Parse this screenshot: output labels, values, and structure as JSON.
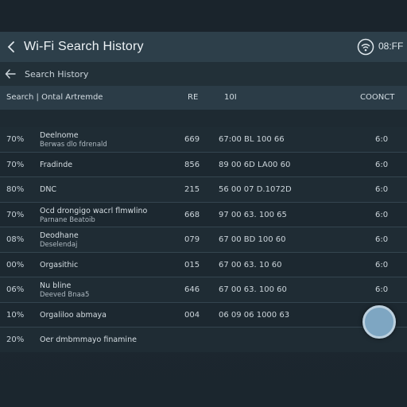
{
  "app": {
    "title": "Wi-Fi Search History",
    "right_label": "08:FF",
    "back_icon": "arrow-left-icon",
    "wifi_icon": "wifi-icon"
  },
  "subbar": {
    "title": "Search History",
    "back_icon": "arrow-left-icon"
  },
  "table": {
    "headers": {
      "col1": "Search | Ontal Artremde",
      "col2": "RE",
      "col3": "10I",
      "col4": "COONCT"
    },
    "rows": [
      {
        "pct": "70%",
        "name": "Deelnome",
        "sub": "Berwas dlo fdrenald",
        "rs": "669",
        "id": "67:00 BL 100 66",
        "cnt": "6:0"
      },
      {
        "pct": "70%",
        "name": "Fradinde",
        "sub": "",
        "rs": "856",
        "id": "89 00 6D LA00 60",
        "cnt": "6:0"
      },
      {
        "pct": "80%",
        "name": "DNC",
        "sub": "",
        "rs": "215",
        "id": "56 00 07 D.1072D",
        "cnt": "6:0"
      },
      {
        "pct": "70%",
        "name": "Ocd drongigo wacrl flmwlino",
        "sub": "Parnane Beatoib",
        "rs": "668",
        "id": "97 00 63. 100 65",
        "cnt": "6:0"
      },
      {
        "pct": "08%",
        "name": "Deodhane",
        "sub": "Deselendaj",
        "rs": "079",
        "id": "67 00 BD 100 60",
        "cnt": "6:0"
      },
      {
        "pct": "00%",
        "name": "Orgasithic",
        "sub": "",
        "rs": "015",
        "id": "67 00 63. 10 60",
        "cnt": "6:0"
      },
      {
        "pct": "06%",
        "name": "Nu bline",
        "sub": "Deeved Bnaa5",
        "rs": "646",
        "id": "67 00 63. 100 60",
        "cnt": "6:0"
      },
      {
        "pct": "10%",
        "name": "Orgaliloo abmaya",
        "sub": "",
        "rs": "004",
        "id": "06 09 06 1000 63",
        "cnt": ""
      },
      {
        "pct": "20%",
        "name": "Oer dmbmmayo finamine",
        "sub": "",
        "rs": "",
        "id": "",
        "cnt": ""
      }
    ]
  },
  "fab": {
    "icon": "circle-button-icon"
  },
  "colors": {
    "appbar": "#2d3f4a",
    "background": "#1e2a33",
    "fab": "#7ea6c2"
  }
}
